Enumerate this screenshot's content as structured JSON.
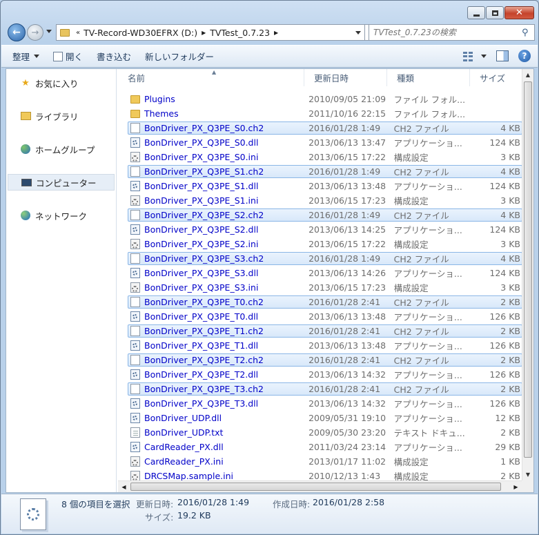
{
  "window": {
    "caption_buttons": [
      "minimize",
      "maximize",
      "close"
    ]
  },
  "address": {
    "overflow": "«",
    "crumbs": [
      "TV-Record-WD30EFRX (D:)",
      "TVTest_0.7.23"
    ],
    "search_placeholder": "TVTest_0.7.23の検索"
  },
  "toolbar": {
    "organize": "整理",
    "open": "開く",
    "burn": "書き込む",
    "new_folder": "新しいフォルダー"
  },
  "nav": {
    "favorites": "お気に入り",
    "libraries": "ライブラリ",
    "homegroup": "ホームグループ",
    "computer": "コンピューター",
    "network": "ネットワーク"
  },
  "columns": {
    "name": "名前",
    "date": "更新日時",
    "type": "種類",
    "size": "サイズ"
  },
  "files": [
    {
      "name": "Plugins",
      "date": "2010/09/05 21:09",
      "type": "ファイル フォル...",
      "size": "",
      "icon": "folder",
      "selected": false
    },
    {
      "name": "Themes",
      "date": "2011/10/16 22:15",
      "type": "ファイル フォル...",
      "size": "",
      "icon": "folder",
      "selected": false
    },
    {
      "name": "BonDriver_PX_Q3PE_S0.ch2",
      "date": "2016/01/28 1:49",
      "type": "CH2 ファイル",
      "size": "4 KB",
      "icon": "file",
      "selected": true
    },
    {
      "name": "BonDriver_PX_Q3PE_S0.dll",
      "date": "2013/06/13 13:47",
      "type": "アプリケーショ...",
      "size": "124 KB",
      "icon": "dll",
      "selected": false
    },
    {
      "name": "BonDriver_PX_Q3PE_S0.ini",
      "date": "2013/06/15 17:22",
      "type": "構成設定",
      "size": "3 KB",
      "icon": "ini",
      "selected": false
    },
    {
      "name": "BonDriver_PX_Q3PE_S1.ch2",
      "date": "2016/01/28 1:49",
      "type": "CH2 ファイル",
      "size": "4 KB",
      "icon": "file",
      "selected": true
    },
    {
      "name": "BonDriver_PX_Q3PE_S1.dll",
      "date": "2013/06/13 13:48",
      "type": "アプリケーショ...",
      "size": "124 KB",
      "icon": "dll",
      "selected": false
    },
    {
      "name": "BonDriver_PX_Q3PE_S1.ini",
      "date": "2013/06/15 17:23",
      "type": "構成設定",
      "size": "3 KB",
      "icon": "ini",
      "selected": false
    },
    {
      "name": "BonDriver_PX_Q3PE_S2.ch2",
      "date": "2016/01/28 1:49",
      "type": "CH2 ファイル",
      "size": "4 KB",
      "icon": "file",
      "selected": true
    },
    {
      "name": "BonDriver_PX_Q3PE_S2.dll",
      "date": "2013/06/13 14:25",
      "type": "アプリケーショ...",
      "size": "124 KB",
      "icon": "dll",
      "selected": false
    },
    {
      "name": "BonDriver_PX_Q3PE_S2.ini",
      "date": "2013/06/15 17:22",
      "type": "構成設定",
      "size": "3 KB",
      "icon": "ini",
      "selected": false
    },
    {
      "name": "BonDriver_PX_Q3PE_S3.ch2",
      "date": "2016/01/28 1:49",
      "type": "CH2 ファイル",
      "size": "4 KB",
      "icon": "file",
      "selected": true
    },
    {
      "name": "BonDriver_PX_Q3PE_S3.dll",
      "date": "2013/06/13 14:26",
      "type": "アプリケーショ...",
      "size": "124 KB",
      "icon": "dll",
      "selected": false
    },
    {
      "name": "BonDriver_PX_Q3PE_S3.ini",
      "date": "2013/06/15 17:23",
      "type": "構成設定",
      "size": "3 KB",
      "icon": "ini",
      "selected": false
    },
    {
      "name": "BonDriver_PX_Q3PE_T0.ch2",
      "date": "2016/01/28 2:41",
      "type": "CH2 ファイル",
      "size": "2 KB",
      "icon": "file",
      "selected": true
    },
    {
      "name": "BonDriver_PX_Q3PE_T0.dll",
      "date": "2013/06/13 13:48",
      "type": "アプリケーショ...",
      "size": "126 KB",
      "icon": "dll",
      "selected": false
    },
    {
      "name": "BonDriver_PX_Q3PE_T1.ch2",
      "date": "2016/01/28 2:41",
      "type": "CH2 ファイル",
      "size": "2 KB",
      "icon": "file",
      "selected": true
    },
    {
      "name": "BonDriver_PX_Q3PE_T1.dll",
      "date": "2013/06/13 13:48",
      "type": "アプリケーショ...",
      "size": "126 KB",
      "icon": "dll",
      "selected": false
    },
    {
      "name": "BonDriver_PX_Q3PE_T2.ch2",
      "date": "2016/01/28 2:41",
      "type": "CH2 ファイル",
      "size": "2 KB",
      "icon": "file",
      "selected": true
    },
    {
      "name": "BonDriver_PX_Q3PE_T2.dll",
      "date": "2013/06/13 14:32",
      "type": "アプリケーショ...",
      "size": "126 KB",
      "icon": "dll",
      "selected": false
    },
    {
      "name": "BonDriver_PX_Q3PE_T3.ch2",
      "date": "2016/01/28 2:41",
      "type": "CH2 ファイル",
      "size": "2 KB",
      "icon": "file",
      "selected": true
    },
    {
      "name": "BonDriver_PX_Q3PE_T3.dll",
      "date": "2013/06/13 14:32",
      "type": "アプリケーショ...",
      "size": "126 KB",
      "icon": "dll",
      "selected": false
    },
    {
      "name": "BonDriver_UDP.dll",
      "date": "2009/05/31 19:10",
      "type": "アプリケーショ...",
      "size": "12 KB",
      "icon": "dll",
      "selected": false
    },
    {
      "name": "BonDriver_UDP.txt",
      "date": "2009/05/30 23:20",
      "type": "テキスト ドキュ...",
      "size": "2 KB",
      "icon": "txt",
      "selected": false
    },
    {
      "name": "CardReader_PX.dll",
      "date": "2011/03/24 23:14",
      "type": "アプリケーショ...",
      "size": "29 KB",
      "icon": "dll",
      "selected": false
    },
    {
      "name": "CardReader_PX.ini",
      "date": "2013/01/17 11:02",
      "type": "構成設定",
      "size": "1 KB",
      "icon": "ini",
      "selected": false
    },
    {
      "name": "DRCSMap.sample.ini",
      "date": "2010/12/13 1:43",
      "type": "構成設定",
      "size": "2 KB",
      "icon": "ini",
      "selected": false
    }
  ],
  "details": {
    "selection": "8 個の項目を選択",
    "modified_label": "更新日時:",
    "modified_value": "2016/01/28 1:49",
    "created_label": "作成日時:",
    "created_value": "2016/01/28 2:58",
    "size_label": "サイズ:",
    "size_value": "19.2 KB"
  }
}
